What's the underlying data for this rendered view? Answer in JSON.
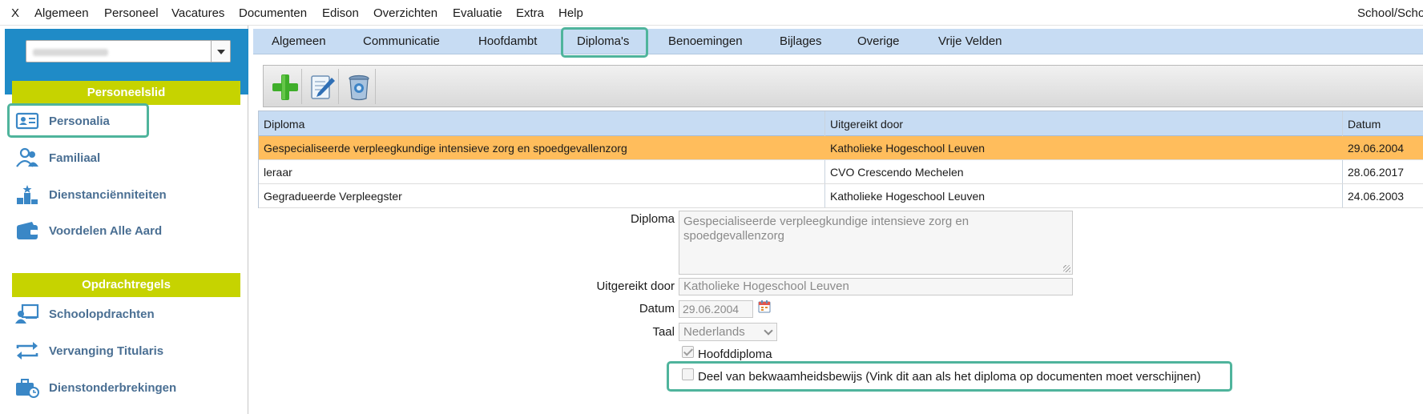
{
  "menubar": {
    "items": [
      "X",
      "Algemeen",
      "Personeel",
      "Vacatures",
      "Documenten",
      "Edison",
      "Overzichten",
      "Evaluatie",
      "Extra",
      "Help"
    ],
    "context_label": "School/Scho"
  },
  "sidebar": {
    "person_select_value": "",
    "section_personeelslid": "Personeelslid",
    "personeelslid_items": [
      {
        "label": "Personalia",
        "icon": "id-card-icon"
      },
      {
        "label": "Familiaal",
        "icon": "people-icon"
      },
      {
        "label": "Dienstanciënniteiten",
        "icon": "podium-icon"
      },
      {
        "label": "Voordelen Alle Aard",
        "icon": "wallet-icon"
      }
    ],
    "section_opdrachtregels": "Opdrachtregels",
    "opdracht_items": [
      {
        "label": "Schoolopdrachten",
        "icon": "teacher-board-icon"
      },
      {
        "label": "Vervanging Titularis",
        "icon": "swap-arrows-icon"
      },
      {
        "label": "Dienstonderbrekingen",
        "icon": "briefcase-clock-icon"
      }
    ]
  },
  "tabs": [
    "Algemeen",
    "Communicatie",
    "Hoofdambt",
    "Diploma's",
    "Benoemingen",
    "Bijlages",
    "Overige",
    "Vrije Velden"
  ],
  "active_tab": "Diploma's",
  "toolbar": {
    "buttons": [
      {
        "name": "add",
        "icon": "plus-icon"
      },
      {
        "name": "edit",
        "icon": "pencil-icon"
      },
      {
        "name": "delete",
        "icon": "trash-icon"
      }
    ]
  },
  "grid": {
    "columns": [
      "Diploma",
      "Uitgereikt door",
      "Datum"
    ],
    "rows": [
      {
        "diploma": "Gespecialiseerde verpleegkundige intensieve zorg en spoedgevallenzorg",
        "uitgereikt_door": "Katholieke Hogeschool Leuven",
        "datum": "29.06.2004",
        "selected": true
      },
      {
        "diploma": "leraar",
        "uitgereikt_door": "CVO Crescendo Mechelen",
        "datum": "28.06.2017",
        "selected": false
      },
      {
        "diploma": "Gegradueerde Verpleegster",
        "uitgereikt_door": "Katholieke Hogeschool Leuven",
        "datum": "24.06.2003",
        "selected": false
      }
    ]
  },
  "form": {
    "diploma_label": "Diploma",
    "diploma_value": "Gespecialiseerde verpleegkundige intensieve zorg en spoedgevallenzorg",
    "uitgereikt_label": "Uitgereikt door",
    "uitgereikt_value": "Katholieke Hogeschool Leuven",
    "datum_label": "Datum",
    "datum_value": "29.06.2004",
    "taal_label": "Taal",
    "taal_value": "Nederlands",
    "hoofddiploma_label": "Hoofddiploma",
    "hoofddiploma_checked": true,
    "bekwaamheid_label": "Deel van bekwaamheidsbewijs (Vink dit aan als het diploma op documenten moet verschijnen)",
    "bekwaamheid_checked": false
  },
  "colors": {
    "accent_blue": "#1f8bc7",
    "section_green": "#c6d300",
    "tab_bg": "#c7dcf3",
    "selected_row": "#ffbd5c",
    "highlight": "#4fb49c",
    "sidebar_link": "#4a6f93"
  }
}
